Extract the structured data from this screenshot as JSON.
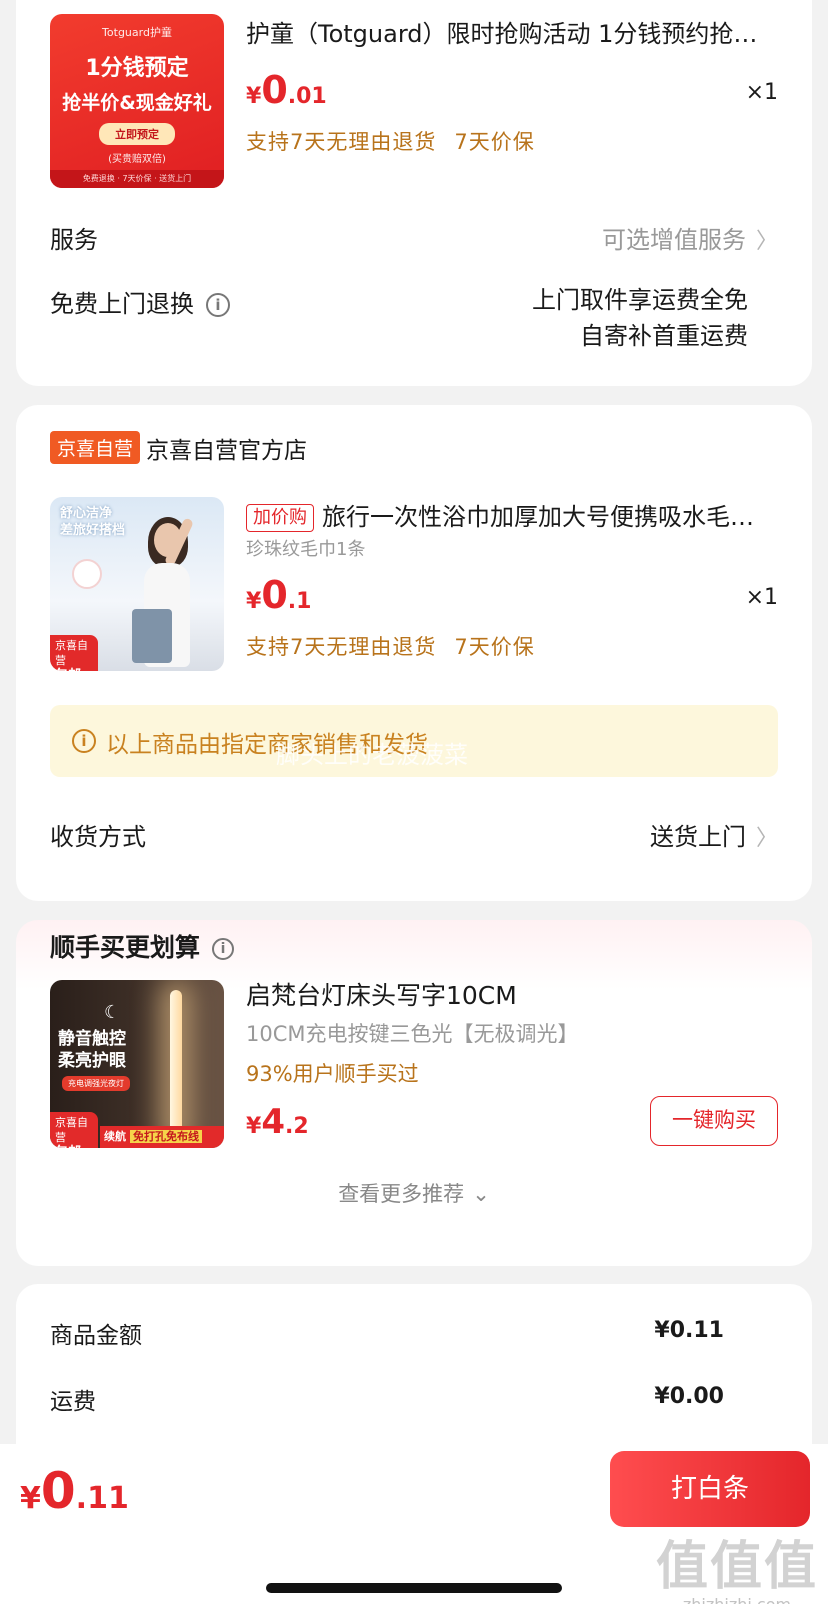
{
  "item1": {
    "title": "护童（Totguard）限时抢购活动 1分钱预约抢…",
    "price_yen": "¥",
    "price_int": "0",
    "price_dec": ".01",
    "qty": "×1",
    "guarantee_1": "支持7天无理由退货",
    "guarantee_2": "7天价保",
    "thumb": {
      "brand": "Totguard护童",
      "line1": "1分钱预定",
      "line2": "抢半价&现金好礼",
      "button": "立即预定",
      "sub": "(买贵赔双倍)",
      "foot": "免费退换 · 7天价保 · 送货上门"
    }
  },
  "service": {
    "label": "服务",
    "value": "可选增值服务"
  },
  "free_return": {
    "label": "免费上门退换",
    "line1": "上门取件享运费全免",
    "line2": "自寄补首重运费"
  },
  "shop": {
    "badge": "京喜自营",
    "name": "京喜自营官方店"
  },
  "item2": {
    "tag": "加价购",
    "title": "旅行一次性浴巾加厚加大号便携吸水毛…",
    "spec": "珍珠纹毛巾1条",
    "price_yen": "¥",
    "price_int": "0",
    "price_dec": ".1",
    "qty": "×1",
    "guarantee_1": "支持7天无理由退货",
    "guarantee_2": "7天价保",
    "thumb": {
      "line1": "舒心洁净",
      "line2": "差旅好搭档",
      "tag_line1": "京喜自营",
      "tag_line2": "包邮"
    }
  },
  "notice": {
    "text": "以上商品由指定商家销售和发货",
    "watermark": "脚头上的老菠菠菜"
  },
  "delivery": {
    "label": "收货方式",
    "value": "送货上门"
  },
  "recommend": {
    "section_title": "顺手买更划算",
    "title": "启梵台灯床头写字10CM",
    "spec": "10CM充电按键三色光【无极调光】",
    "percent": "93%用户顺手买过",
    "price_yen": "¥",
    "price_int": "4",
    "price_dec": ".2",
    "button": "一键购买",
    "more": "查看更多推荐",
    "thumb": {
      "line1": "静音触控",
      "line2": "柔亮护眼",
      "pill": "充电调强光夜灯",
      "tag_line1": "京喜自营",
      "tag_line2": "包邮",
      "bar_a": "续航",
      "bar_b": "免打孔免布线"
    }
  },
  "summary": {
    "goods_label": "商品金额",
    "goods_value": "¥0.11",
    "shipping_label": "运费",
    "shipping_value": "¥0.00"
  },
  "bottom": {
    "total_yen": "¥",
    "total_int": "0",
    "total_dec": ".11",
    "pay_button": "打白条",
    "site_big": "值值值",
    "site_small": "zhizhizhi.com"
  },
  "colors": {
    "accent_red": "#e4262b",
    "guarantee_orange": "#b8731b",
    "shop_badge": "#f05a23",
    "notice_bg": "#fdf7dc"
  }
}
